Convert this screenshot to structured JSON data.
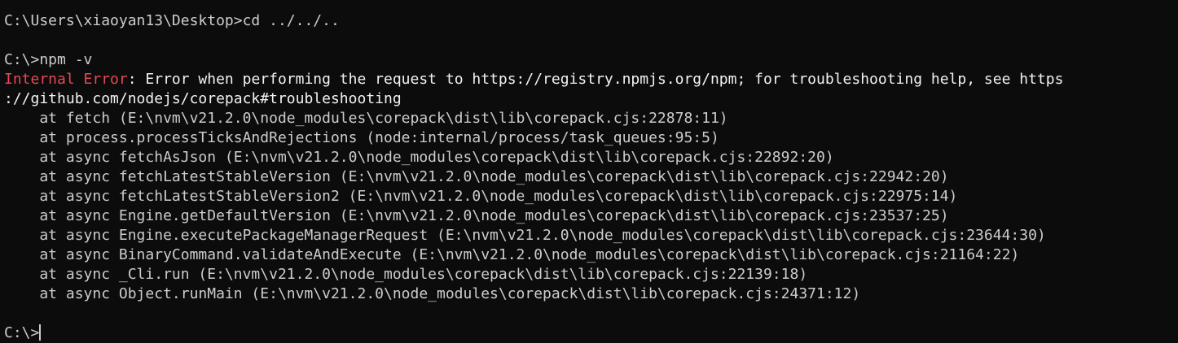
{
  "terminal": {
    "lines": {
      "cmd1": "C:\\Users\\xiaoyan13\\Desktop>cd ../../..",
      "cmd2": "C:\\>npm -v",
      "error_label": "Internal Error",
      "error_colon": ":",
      "error_message": " Error when performing the request to https://registry.npmjs.org/npm; for troubleshooting help, see https",
      "error_message_wrap": "://github.com/nodejs/corepack#troubleshooting",
      "stack_1": "    at fetch (E:\\nvm\\v21.2.0\\node_modules\\corepack\\dist\\lib\\corepack.cjs:22878:11)",
      "stack_2": "    at process.processTicksAndRejections (node:internal/process/task_queues:95:5)",
      "stack_3": "    at async fetchAsJson (E:\\nvm\\v21.2.0\\node_modules\\corepack\\dist\\lib\\corepack.cjs:22892:20)",
      "stack_4": "    at async fetchLatestStableVersion (E:\\nvm\\v21.2.0\\node_modules\\corepack\\dist\\lib\\corepack.cjs:22942:20)",
      "stack_5": "    at async fetchLatestStableVersion2 (E:\\nvm\\v21.2.0\\node_modules\\corepack\\dist\\lib\\corepack.cjs:22975:14)",
      "stack_6": "    at async Engine.getDefaultVersion (E:\\nvm\\v21.2.0\\node_modules\\corepack\\dist\\lib\\corepack.cjs:23537:25)",
      "stack_7": "    at async Engine.executePackageManagerRequest (E:\\nvm\\v21.2.0\\node_modules\\corepack\\dist\\lib\\corepack.cjs:23644:30)",
      "stack_8": "    at async BinaryCommand.validateAndExecute (E:\\nvm\\v21.2.0\\node_modules\\corepack\\dist\\lib\\corepack.cjs:21164:22)",
      "stack_9": "    at async _Cli.run (E:\\nvm\\v21.2.0\\node_modules\\corepack\\dist\\lib\\corepack.cjs:22139:18)",
      "stack_10": "    at async Object.runMain (E:\\nvm\\v21.2.0\\node_modules\\corepack\\dist\\lib\\corepack.cjs:24371:12)",
      "prompt": "C:\\>"
    },
    "colors": {
      "background": "#0c0c0c",
      "text": "#cccccc",
      "error_label": "#e74856",
      "error_text": "#f2f2f2"
    }
  }
}
